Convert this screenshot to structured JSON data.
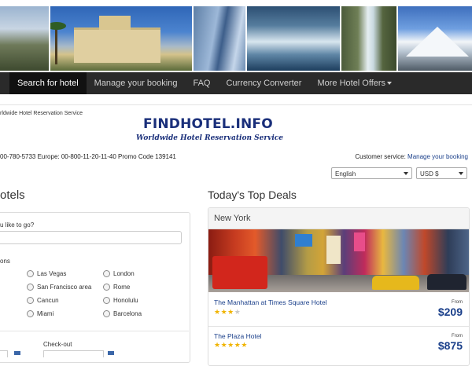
{
  "nav": {
    "items": [
      {
        "label": "Search for hotel"
      },
      {
        "label": "Manage your booking"
      },
      {
        "label": "FAQ"
      },
      {
        "label": "Currency Converter"
      },
      {
        "label": "More Hotel Offers"
      }
    ]
  },
  "header": {
    "tagline_small": "rldwide Hotel Reservation Service",
    "logo_title": "FINDHOTEL.INFO",
    "logo_subtitle": "Worldwide Hotel Reservation Service",
    "phones": "00-780-5733 Europe: 00-800-11-20-11-40 Promo Code 139141",
    "service_prefix": "Customer service:",
    "service_link": "Manage your booking"
  },
  "selects": {
    "language": "English",
    "currency": "USD $"
  },
  "search": {
    "section_title": "otels",
    "question_label": "u like to go?",
    "destination_value": "",
    "popular_label": "ons",
    "destinations": [
      {
        "label": "Las Vegas"
      },
      {
        "label": "London"
      },
      {
        "label": "San Francisco area"
      },
      {
        "label": "Rome"
      },
      {
        "label": "Cancun"
      },
      {
        "label": "Honolulu"
      },
      {
        "label": "Miami"
      },
      {
        "label": "Barcelona"
      }
    ],
    "checkout_label": "Check-out"
  },
  "deals": {
    "title": "Today's Top Deals",
    "city": "New York",
    "hotels": [
      {
        "name": "The Manhattan at Times Square Hotel",
        "stars": 3,
        "max_stars": 4,
        "from": "From",
        "price": "$209"
      },
      {
        "name": "The Plaza Hotel",
        "stars": 5,
        "max_stars": 5,
        "from": "From",
        "price": "$875"
      }
    ]
  },
  "colors": {
    "nav_bg": "#2a2a2a",
    "brand_blue": "#1a2f7a",
    "link_blue": "#1a3f8a",
    "star": "#f0b400"
  }
}
